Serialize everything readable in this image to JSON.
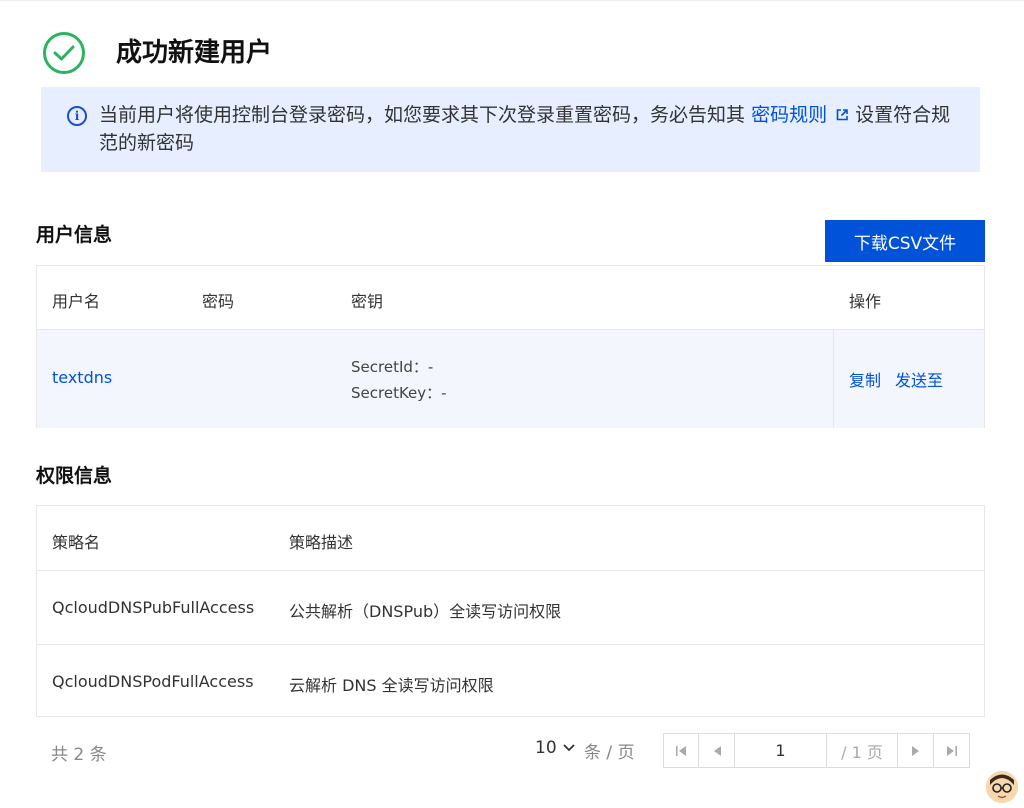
{
  "header": {
    "title": "成功新建用户"
  },
  "notice": {
    "text_before": "当前用户将使用控制台登录密码，如您要求其下次登录重置密码，务必告知其",
    "link": "密码规则",
    "text_after": "设置符合规范的新密码"
  },
  "user_section": {
    "title": "用户信息",
    "download_label": "下载CSV文件",
    "columns": [
      "用户名",
      "密码",
      "密钥",
      "操作"
    ],
    "row": {
      "username": "textdns",
      "secret_id": "SecretId：-",
      "secret_key": "SecretKey：-",
      "action_copy": "复制",
      "action_send": "发送至"
    }
  },
  "perm_section": {
    "title": "权限信息",
    "columns": [
      "策略名",
      "策略描述"
    ],
    "rows": [
      {
        "name": "QcloudDNSPubFullAccess",
        "desc": "公共解析（DNSPub）全读写访问权限"
      },
      {
        "name": "QcloudDNSPodFullAccess",
        "desc": "云解析 DNS 全读写访问权限"
      }
    ]
  },
  "pagination": {
    "total": "共 2 条",
    "page_size": "10",
    "page_size_unit": "条 / 页",
    "current_page": "1",
    "total_pages": "/ 1 页"
  },
  "colors": {
    "primary": "#0052d9",
    "success": "#2db360",
    "notice_bg": "#e6eeff"
  }
}
